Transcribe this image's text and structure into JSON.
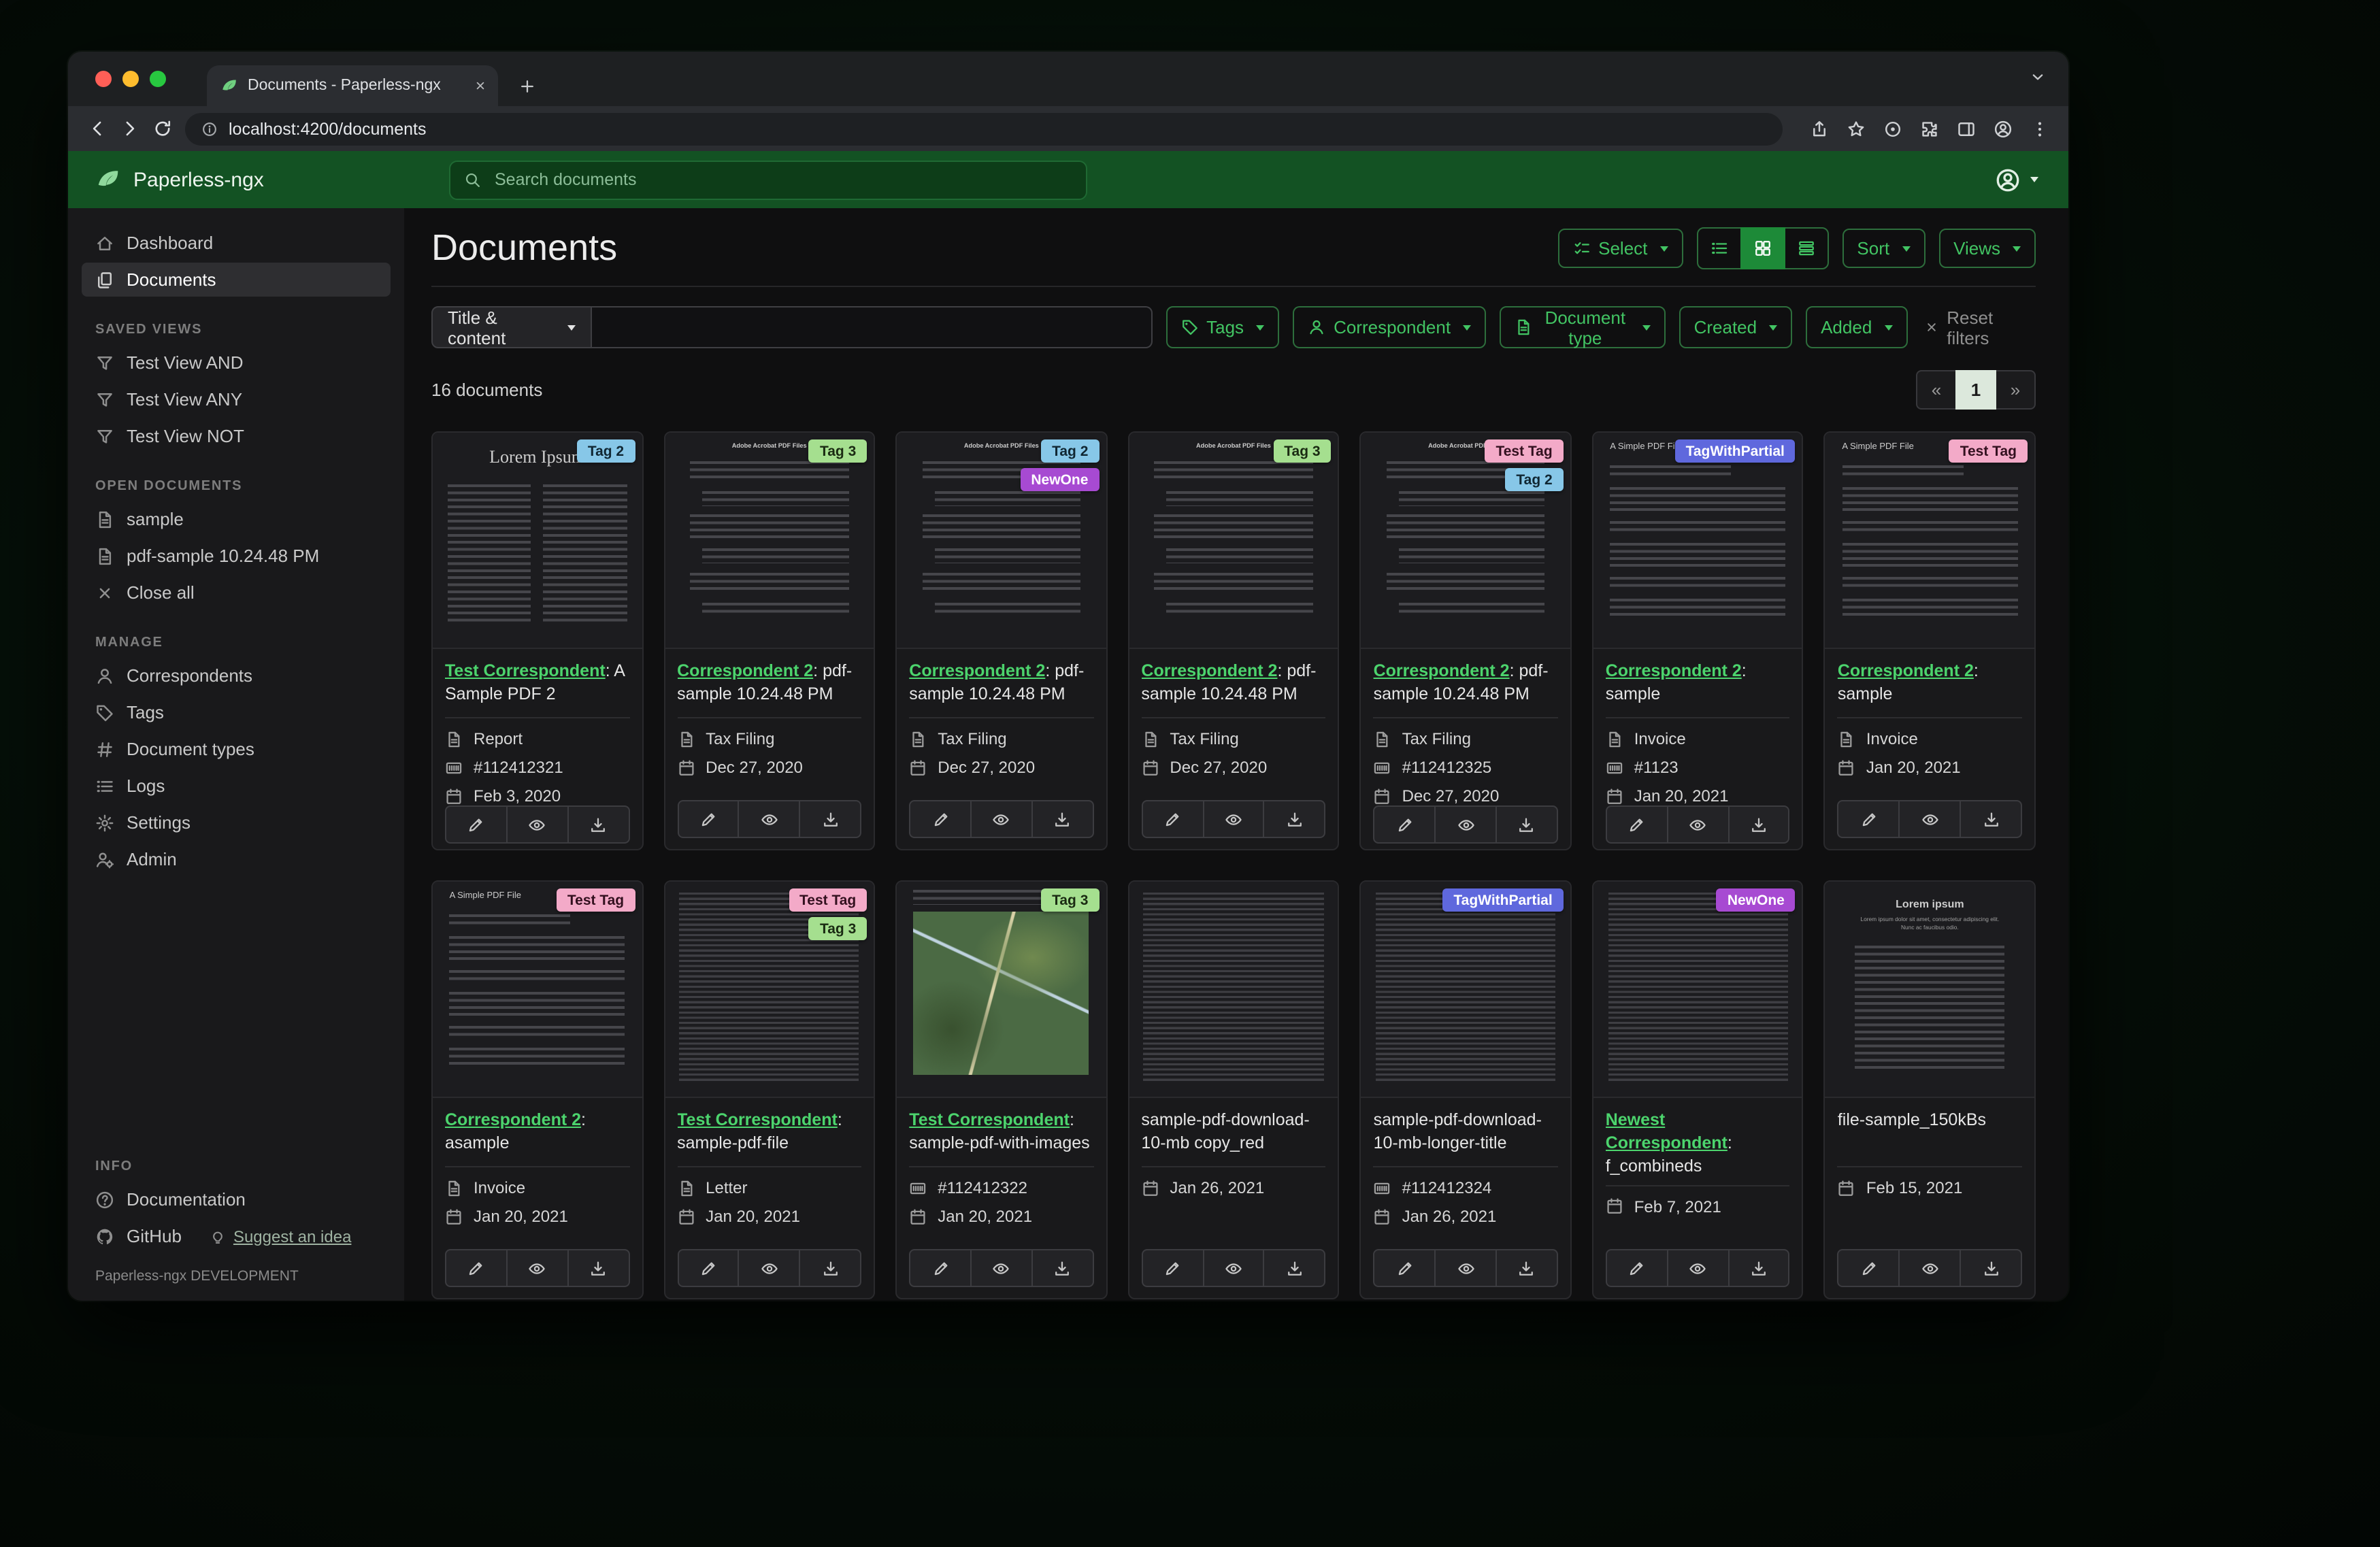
{
  "browser": {
    "tab_title": "Documents - Paperless-ngx",
    "url": "localhost:4200/documents"
  },
  "header": {
    "brand": "Paperless-ngx",
    "search_placeholder": "Search documents"
  },
  "sidebar": {
    "items_primary": [
      {
        "icon": "house",
        "label": "Dashboard",
        "active": false
      },
      {
        "icon": "documents",
        "label": "Documents",
        "active": true
      }
    ],
    "sections": [
      {
        "title": "SAVED VIEWS",
        "items": [
          {
            "icon": "funnel",
            "label": "Test View AND"
          },
          {
            "icon": "funnel",
            "label": "Test View ANY"
          },
          {
            "icon": "funnel",
            "label": "Test View NOT"
          }
        ]
      },
      {
        "title": "OPEN DOCUMENTS",
        "items": [
          {
            "icon": "file-text",
            "label": "sample"
          },
          {
            "icon": "file-text",
            "label": "pdf-sample 10.24.48 PM"
          },
          {
            "icon": "close-x",
            "label": "Close all"
          }
        ]
      },
      {
        "title": "MANAGE",
        "items": [
          {
            "icon": "person",
            "label": "Correspondents"
          },
          {
            "icon": "tag",
            "label": "Tags"
          },
          {
            "icon": "hash",
            "label": "Document types"
          },
          {
            "icon": "list",
            "label": "Logs"
          },
          {
            "icon": "gear",
            "label": "Settings"
          },
          {
            "icon": "person-gear",
            "label": "Admin"
          }
        ]
      },
      {
        "title": "INFO",
        "items": [
          {
            "icon": "question-circle",
            "label": "Documentation"
          },
          {
            "icon": "github",
            "label": "GitHub",
            "extra_icon": "lightbulb",
            "extra_label": "Suggest an idea"
          }
        ]
      }
    ],
    "footer": "Paperless-ngx DEVELOPMENT"
  },
  "toolbar": {
    "page_title": "Documents",
    "select_label": "Select",
    "sort_label": "Sort",
    "views_label": "Views"
  },
  "filters": {
    "field_label": "Title & content",
    "query_value": "",
    "buttons": [
      {
        "icon": "tag",
        "label": "Tags"
      },
      {
        "icon": "person",
        "label": "Correspondent"
      },
      {
        "icon": "file-text",
        "label": "Document type"
      },
      {
        "icon": null,
        "label": "Created"
      },
      {
        "icon": null,
        "label": "Added"
      }
    ],
    "reset_label": "Reset filters"
  },
  "results": {
    "count_label": "16 documents",
    "pagination": {
      "prev": "«",
      "page": "1",
      "next": "»"
    }
  },
  "tag_palette": {
    "Tag 2": {
      "bg": "#87c7e8",
      "fg": "#102733"
    },
    "Tag 3": {
      "bg": "#a5df8f",
      "fg": "#1a2b12"
    },
    "NewOne": {
      "bg": "#a74ad2",
      "fg": "#ffffff"
    },
    "Test Tag": {
      "bg": "#f3aac8",
      "fg": "#33101f"
    },
    "TagWithPartial": {
      "bg": "#5f68dd",
      "fg": "#ffffff"
    }
  },
  "thumb_previews": {
    "lorem": {
      "heading": "Lorem Ipsum"
    },
    "acrobat": {
      "heading": "Adobe Acrobat PDF Files"
    },
    "simple": {
      "heading": "A Simple PDF File"
    },
    "map": {
      "heading": ""
    },
    "dense": {
      "heading": ""
    },
    "filesample": {
      "heading": "Lorem ipsum",
      "subheading": "Lorem ipsum dolor sit amet, consectetur adipiscing elit. Nunc ac faucibus odio."
    }
  },
  "cards": [
    {
      "thumb": "lorem",
      "tags": [
        "Tag 2"
      ],
      "correspondent": "Test Correspondent",
      "title": "A Sample PDF 2",
      "meta": [
        [
          "doctype",
          "Report"
        ],
        [
          "asn",
          "#112412321"
        ],
        [
          "date",
          "Feb 3, 2020"
        ]
      ]
    },
    {
      "thumb": "acrobat",
      "tags": [
        "Tag 3"
      ],
      "correspondent": "Correspondent 2",
      "title": "pdf-sample 10.24.48 PM",
      "meta": [
        [
          "doctype",
          "Tax Filing"
        ],
        [
          "date",
          "Dec 27, 2020"
        ]
      ]
    },
    {
      "thumb": "acrobat",
      "tags": [
        "Tag 2",
        "NewOne"
      ],
      "correspondent": "Correspondent 2",
      "title": "pdf-sample 10.24.48 PM",
      "meta": [
        [
          "doctype",
          "Tax Filing"
        ],
        [
          "date",
          "Dec 27, 2020"
        ]
      ]
    },
    {
      "thumb": "acrobat",
      "tags": [
        "Tag 3"
      ],
      "correspondent": "Correspondent 2",
      "title": "pdf-sample 10.24.48 PM",
      "meta": [
        [
          "doctype",
          "Tax Filing"
        ],
        [
          "date",
          "Dec 27, 2020"
        ]
      ]
    },
    {
      "thumb": "acrobat",
      "tags": [
        "Test Tag",
        "Tag 2"
      ],
      "correspondent": "Correspondent 2",
      "title": "pdf-sample 10.24.48 PM",
      "meta": [
        [
          "doctype",
          "Tax Filing"
        ],
        [
          "asn",
          "#112412325"
        ],
        [
          "date",
          "Dec 27, 2020"
        ]
      ]
    },
    {
      "thumb": "simple",
      "tags": [
        "TagWithPartial"
      ],
      "correspondent": "Correspondent 2",
      "title": "sample",
      "meta": [
        [
          "doctype",
          "Invoice"
        ],
        [
          "asn",
          "#1123"
        ],
        [
          "date",
          "Jan 20, 2021"
        ]
      ]
    },
    {
      "thumb": "simple",
      "tags": [
        "Test Tag"
      ],
      "correspondent": "Correspondent 2",
      "title": "sample",
      "meta": [
        [
          "doctype",
          "Invoice"
        ],
        [
          "date",
          "Jan 20, 2021"
        ]
      ]
    },
    {
      "thumb": "simple",
      "tags": [
        "Test Tag"
      ],
      "correspondent": "Correspondent 2",
      "title": "asample",
      "meta": [
        [
          "doctype",
          "Invoice"
        ],
        [
          "date",
          "Jan 20, 2021"
        ]
      ]
    },
    {
      "thumb": "dense",
      "tags": [
        "Test Tag",
        "Tag 3"
      ],
      "correspondent": "Test Correspondent",
      "title": "sample-pdf-file",
      "meta": [
        [
          "doctype",
          "Letter"
        ],
        [
          "date",
          "Jan 20, 2021"
        ]
      ]
    },
    {
      "thumb": "map",
      "tags": [
        "Tag 3"
      ],
      "correspondent": "Test Correspondent",
      "title": "sample-pdf-with-images",
      "meta": [
        [
          "asn",
          "#112412322"
        ],
        [
          "date",
          "Jan 20, 2021"
        ]
      ]
    },
    {
      "thumb": "dense",
      "tags": [],
      "correspondent": null,
      "title": "sample-pdf-download-10-mb copy_red",
      "meta": [
        [
          "date",
          "Jan 26, 2021"
        ]
      ]
    },
    {
      "thumb": "dense",
      "tags": [
        "TagWithPartial"
      ],
      "correspondent": null,
      "title": "sample-pdf-download-10-mb-longer-title",
      "meta": [
        [
          "asn",
          "#112412324"
        ],
        [
          "date",
          "Jan 26, 2021"
        ]
      ]
    },
    {
      "thumb": "dense",
      "tags": [
        "NewOne"
      ],
      "correspondent": "Newest Correspondent",
      "title": "f_combineds",
      "meta": [
        [
          "date",
          "Feb 7, 2021"
        ]
      ]
    },
    {
      "thumb": "filesample",
      "tags": [],
      "correspondent": null,
      "title": "file-sample_150kBs",
      "meta": [
        [
          "date",
          "Feb 15, 2021"
        ]
      ]
    }
  ]
}
